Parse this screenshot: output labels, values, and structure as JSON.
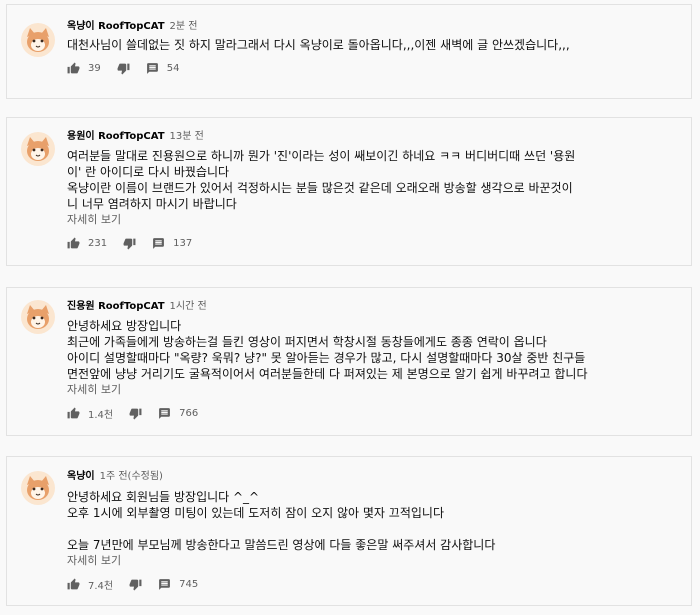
{
  "comments": [
    {
      "author": "옥냥이 RoofTopCAT",
      "time": "2분 전",
      "lines": [
        "대천사님이 쓸데없는 짓 하지 말라그래서 다시 옥냥이로 돌아옵니다,,,이젠 새벽에 글 안쓰겠습니다,,,"
      ],
      "show_more": "",
      "likes": "39",
      "replies": "54"
    },
    {
      "author": "용원이 RoofTopCAT",
      "time": "13분 전",
      "lines": [
        "여러분들 말대로 진용원으로 하니까 뭔가 '진'이라는 성이 쌔보이긴 하네요 ㅋㅋ 버디버디때 쓰던 '용원",
        "이' 란 아이디로 다시 바꿨습니다",
        "옥냥이란 이름이 브랜드가 있어서 걱정하시는 분들 많은것 같은데 오래오래 방송할 생각으로 바꾼것이",
        "니 너무 염려하지 마시기 바랍니다"
      ],
      "show_more": "자세히 보기",
      "likes": "231",
      "replies": "137"
    },
    {
      "author": "진용원 RoofTopCAT",
      "time": "1시간 전",
      "lines": [
        "안녕하세요 방장입니다",
        "최근에 가족들에게 방송하는걸 들킨 영상이 퍼지면서 학창시절 동창들에게도 종종 연락이 옵니다",
        "아이디 설명할때마다 \"옥량? 욱뭐? 냥?\" 못 알아듣는 경우가 많고, 다시 설명할때마다 30살 중반 친구들",
        "면전앞에 냥냥 거리기도 굴욕적이어서 여러분들한테 다 퍼져있는 제 본명으로 알기 쉽게 바꾸려고 합니다"
      ],
      "show_more": "자세히 보기",
      "likes": "1.4천",
      "replies": "766"
    },
    {
      "author": "옥냥이",
      "time": "1주 전(수정됨)",
      "lines": [
        "안녕하세요 회원님들 방장입니다 ^_^",
        "오후 1시에 외부촬영 미팅이 있는데 도저히 잠이 오지 않아 몇자 끄적입니다",
        "",
        "오늘 7년만에 부모님께 방송한다고 말씀드린 영상에 다들 좋은말 써주셔서 감사합니다"
      ],
      "show_more": "자세히 보기",
      "likes": "7.4천",
      "replies": "745"
    }
  ],
  "icons": {
    "like": "thumbs-up-icon",
    "dislike": "thumbs-down-icon",
    "reply": "comment-icon"
  },
  "colors": {
    "avatar_fur": "#e8a06a",
    "avatar_face": "#fbe6d0",
    "muted_text": "#606060",
    "border": "#e2e2e2"
  }
}
